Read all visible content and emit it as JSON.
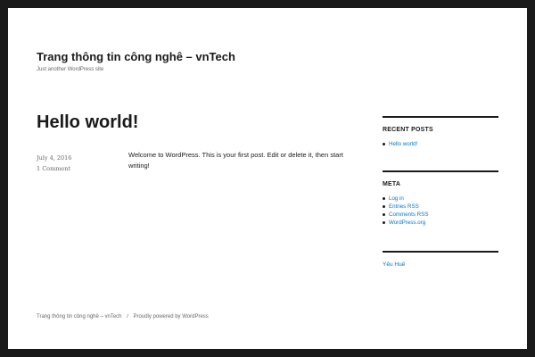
{
  "header": {
    "site_title": "Trang thông tin công nghê – vnTech",
    "site_description": "Just another WordPress site"
  },
  "post": {
    "title": "Hello world!",
    "date": "July 4, 2016",
    "comments": "1 Comment",
    "content": "Welcome to WordPress. This is your first post. Edit or delete it, then start writing!"
  },
  "sidebar": {
    "recent_posts": {
      "title": "RECENT POSTS",
      "items": [
        "Hello world!"
      ]
    },
    "meta": {
      "title": "META",
      "items": [
        "Log in",
        "Entries RSS",
        "Comments RSS",
        "WordPress.org"
      ]
    },
    "text_link": "Yêu Huế"
  },
  "footer": {
    "site_name": "Trang thông tin công nghê – vnTech",
    "separator": "/",
    "powered": "Proudly powered by WordPress"
  },
  "colors": {
    "frame": "#1a1a1a",
    "background": "#ffffff",
    "link": "#007acc",
    "muted": "#686868"
  }
}
